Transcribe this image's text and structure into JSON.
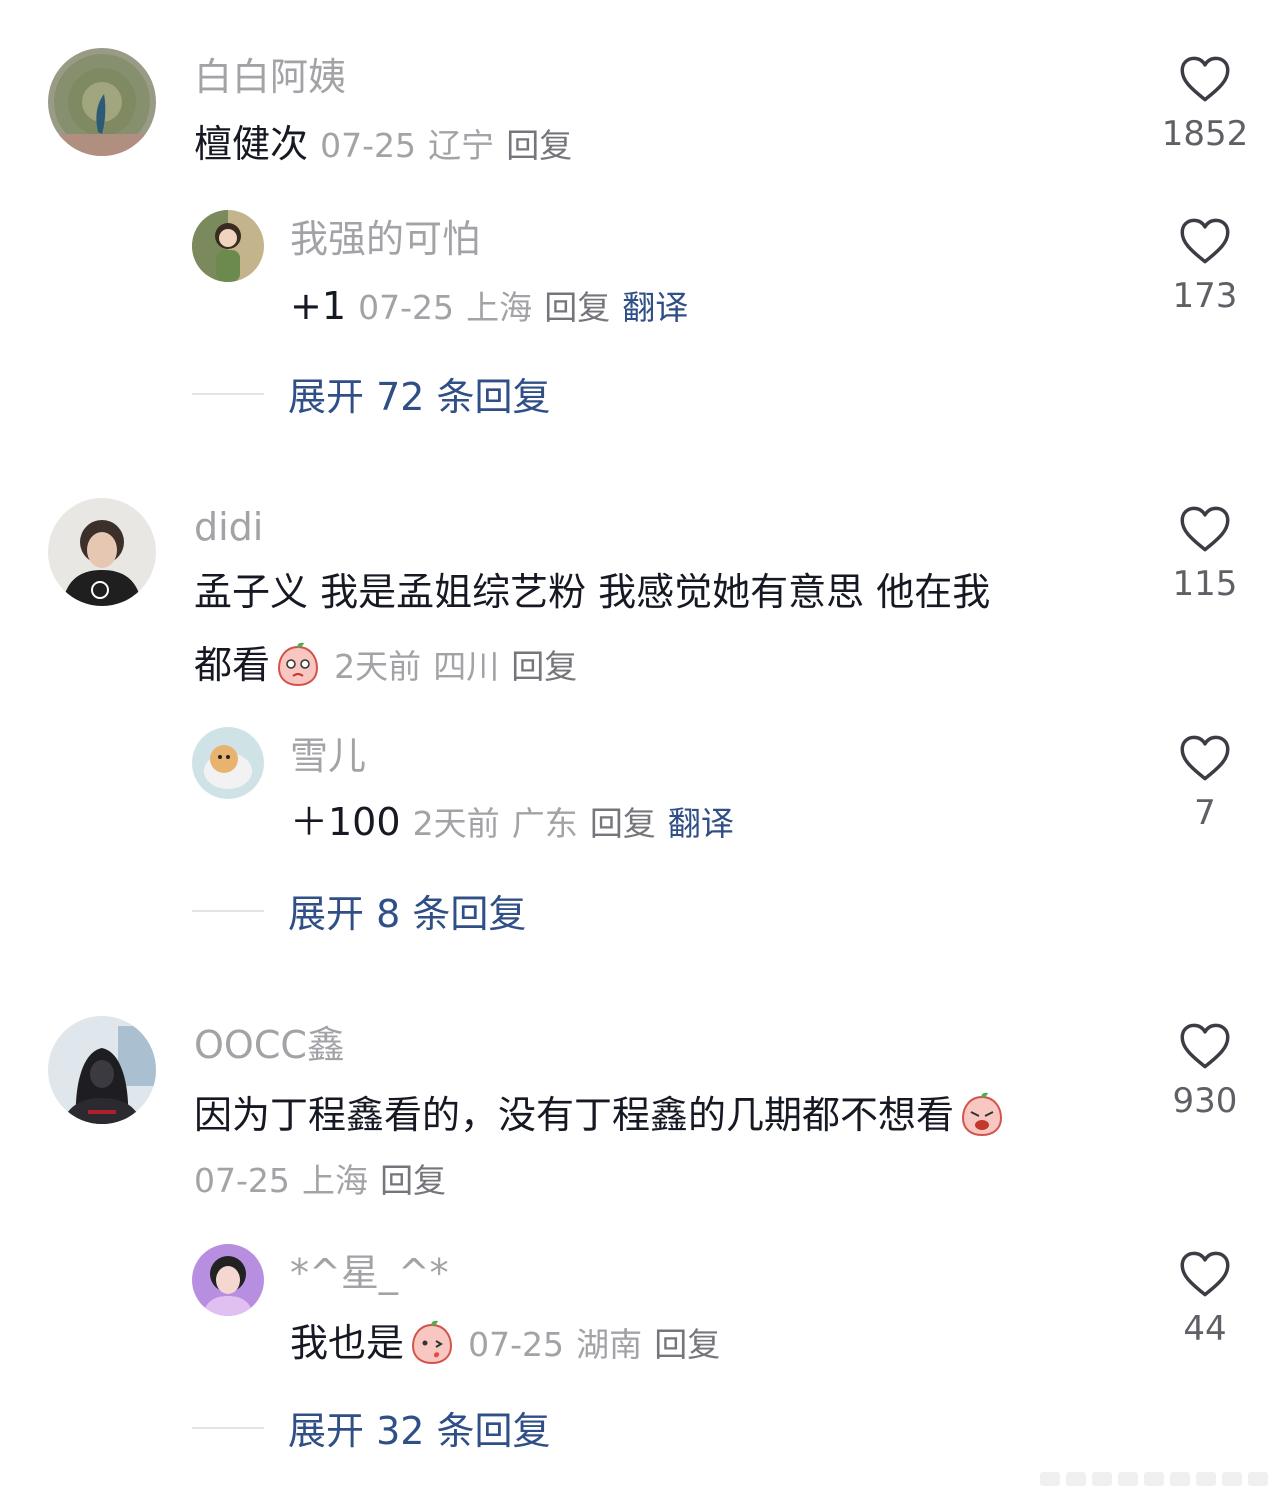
{
  "comments": [
    {
      "user": "白白阿姨",
      "text": "檀健次",
      "date": "07-25",
      "location": "辽宁",
      "reply_label": "回复",
      "likes": "1852",
      "sub_reply": {
        "user": "我强的可怕",
        "text": "+1",
        "date": "07-25",
        "location": "上海",
        "reply_label": "回复",
        "translate_label": "翻译",
        "likes": "173"
      },
      "expand": "展开 72 条回复"
    },
    {
      "user": "didi",
      "text_line1": "孟子义 我是孟姐综艺粉 我感觉她有意思 他在我",
      "text_line2": "都看",
      "emoji": "peach-wink-emoji",
      "date": "2天前",
      "location": "四川",
      "reply_label": "回复",
      "likes": "115",
      "sub_reply": {
        "user": "雪儿",
        "text": "＋100",
        "date": "2天前",
        "location": "广东",
        "reply_label": "回复",
        "translate_label": "翻译",
        "likes": "7"
      },
      "expand": "展开 8 条回复"
    },
    {
      "user": "OOCC鑫",
      "text": "因为丁程鑫看的，没有丁程鑫的几期都不想看",
      "emoji": "peach-crying-emoji",
      "date": "07-25",
      "location": "上海",
      "reply_label": "回复",
      "likes": "930",
      "sub_reply": {
        "user": "*^星_^*",
        "text": "我也是",
        "emoji": "peach-kiss-emoji",
        "date": "07-25",
        "location": "湖南",
        "reply_label": "回复",
        "likes": "44"
      },
      "expand": "展开 32 条回复"
    }
  ],
  "colors": {
    "username": "#a3a3a7",
    "text": "#161823",
    "link": "#2f4f86",
    "meta": "#a3a3a7"
  }
}
